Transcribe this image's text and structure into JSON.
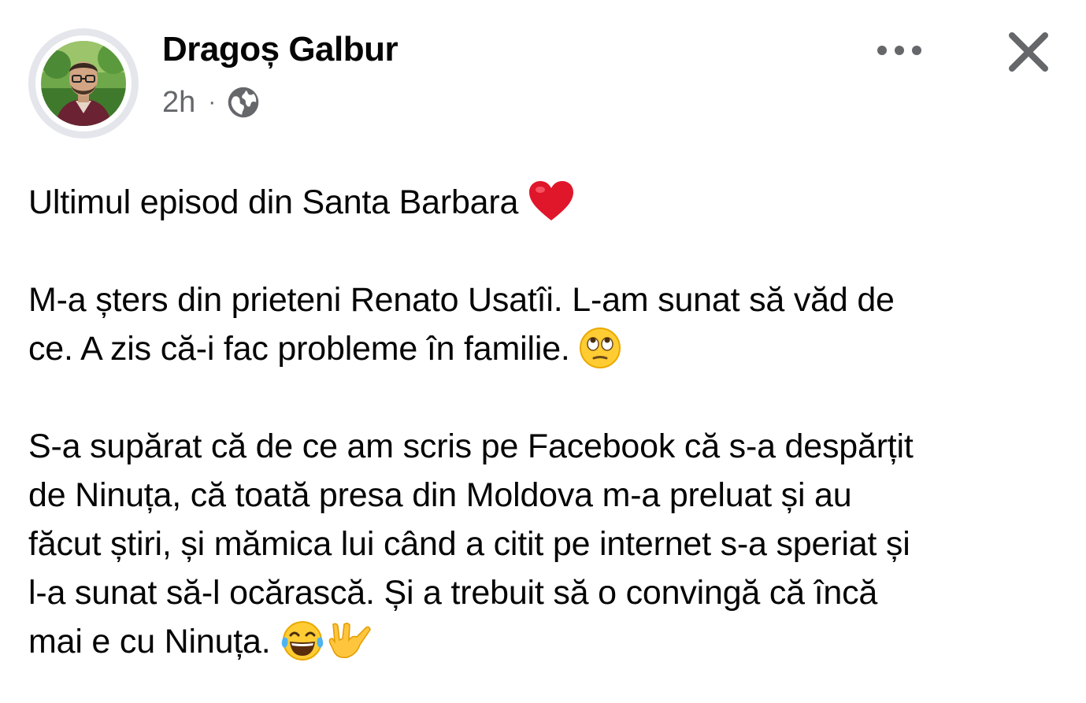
{
  "post": {
    "author": "Dragoș Galbur",
    "time": "2h",
    "separator": "·",
    "privacy_icon": "globe-icon",
    "more_icon": "more-dots-icon",
    "close_icon": "close-icon",
    "paragraphs": [
      [
        "Ultimul episod din Santa Barbara "
      ],
      [
        "M-a șters din prieteni Renato Usatîi. L-am sunat să văd de",
        "ce. A zis că-i fac probleme în familie. "
      ],
      [
        "S-a supărat că de ce am scris pe Facebook că s-a despărțit",
        "de Ninuța, că toată presa din Moldova m-a preluat și au",
        "făcut știri, și mămica lui când a citit pe internet s-a speriat și",
        "l-a sunat să-l ocărască. Și a trebuit să o convingă că încă",
        "mai e cu Ninuța. "
      ]
    ],
    "emojis": [
      "red-heart-emoji",
      "eye-roll-emoji",
      "tears-of-joy-emoji",
      "love-you-gesture-emoji"
    ]
  },
  "colors": {
    "text": "#050505",
    "meta": "#65676b",
    "avatar_ring": "#e4e6eb"
  }
}
